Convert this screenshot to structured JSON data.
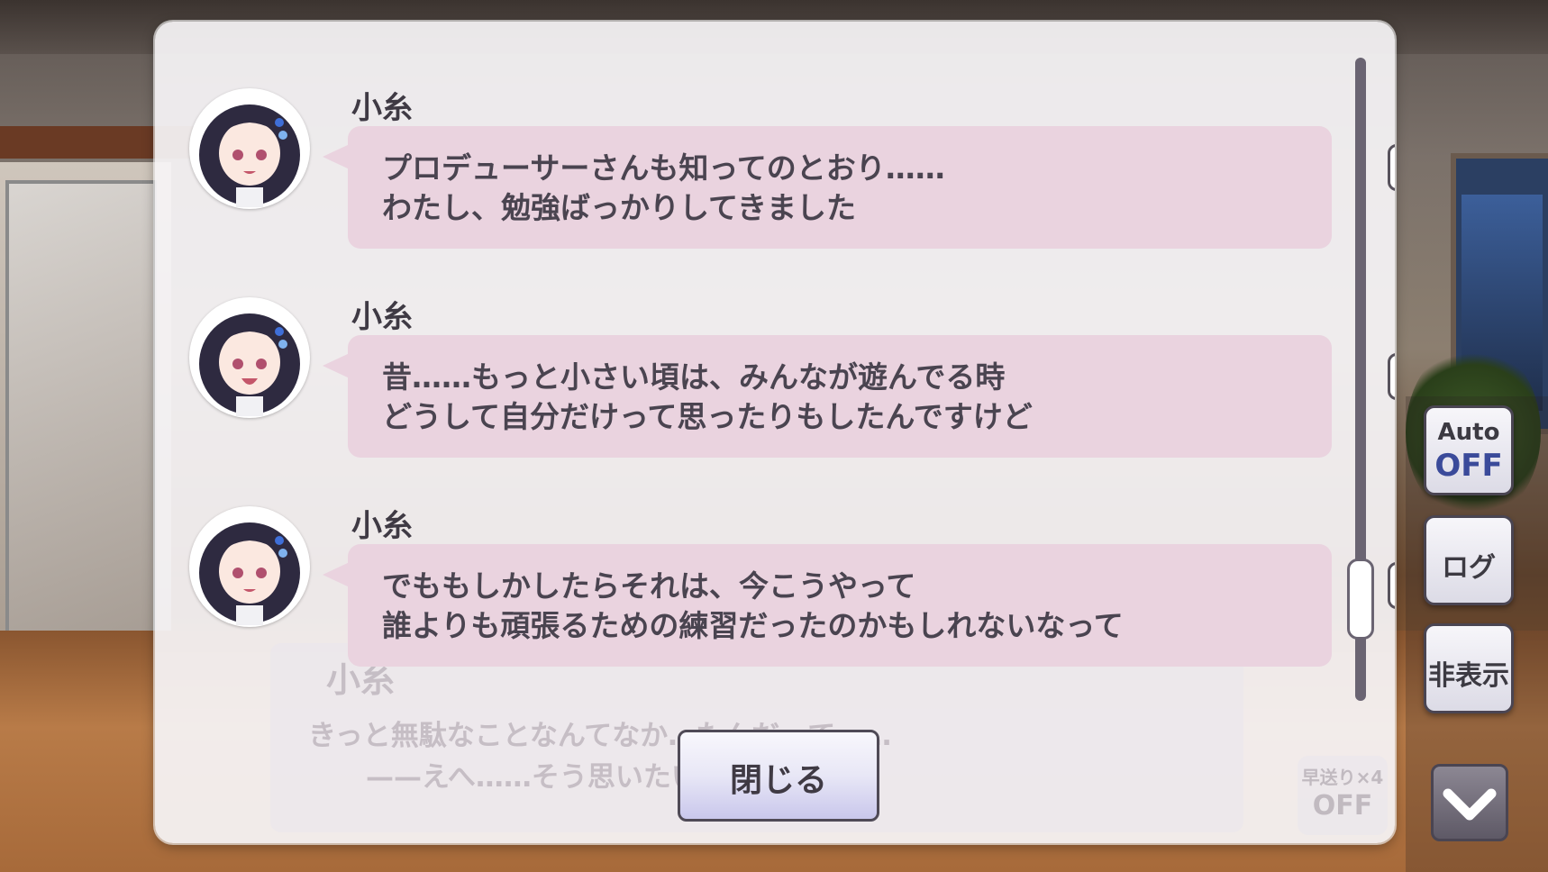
{
  "log_entries": [
    {
      "speaker": "小糸",
      "line1": "プロデューサーさんも知ってのとおり……",
      "line2": "わたし、勉強ばっかりしてきました"
    },
    {
      "speaker": "小糸",
      "line1": "昔……もっと小さい頃は、みんなが遊んでる時",
      "line2": "どうして自分だけって思ったりもしたんですけど"
    },
    {
      "speaker": "小糸",
      "line1": "でももしかしたらそれは、今こうやって",
      "line2": "誰よりも頑張るための練習だったのかもしれないなって"
    }
  ],
  "background_dialog": {
    "speaker": "小糸",
    "line1": "きっと無駄なことなんてなか…たんだ…て……",
    "line2": "——えへ……そう思いたい…ど"
  },
  "fast_forward": {
    "label": "早送り×4",
    "state": "OFF"
  },
  "close_button": {
    "label": "閉じる"
  },
  "side_controls": {
    "auto_label": "Auto",
    "auto_state": "OFF",
    "log_label": "ログ",
    "hide_label": "非表示"
  },
  "icons": {
    "voice": "speaker-play-icon",
    "down": "chevron-down-icon"
  },
  "colors": {
    "bubble": "#ead3df",
    "panel": "#f6f4f6",
    "text": "#4a4450",
    "accent_off": "#3a4a9a"
  }
}
